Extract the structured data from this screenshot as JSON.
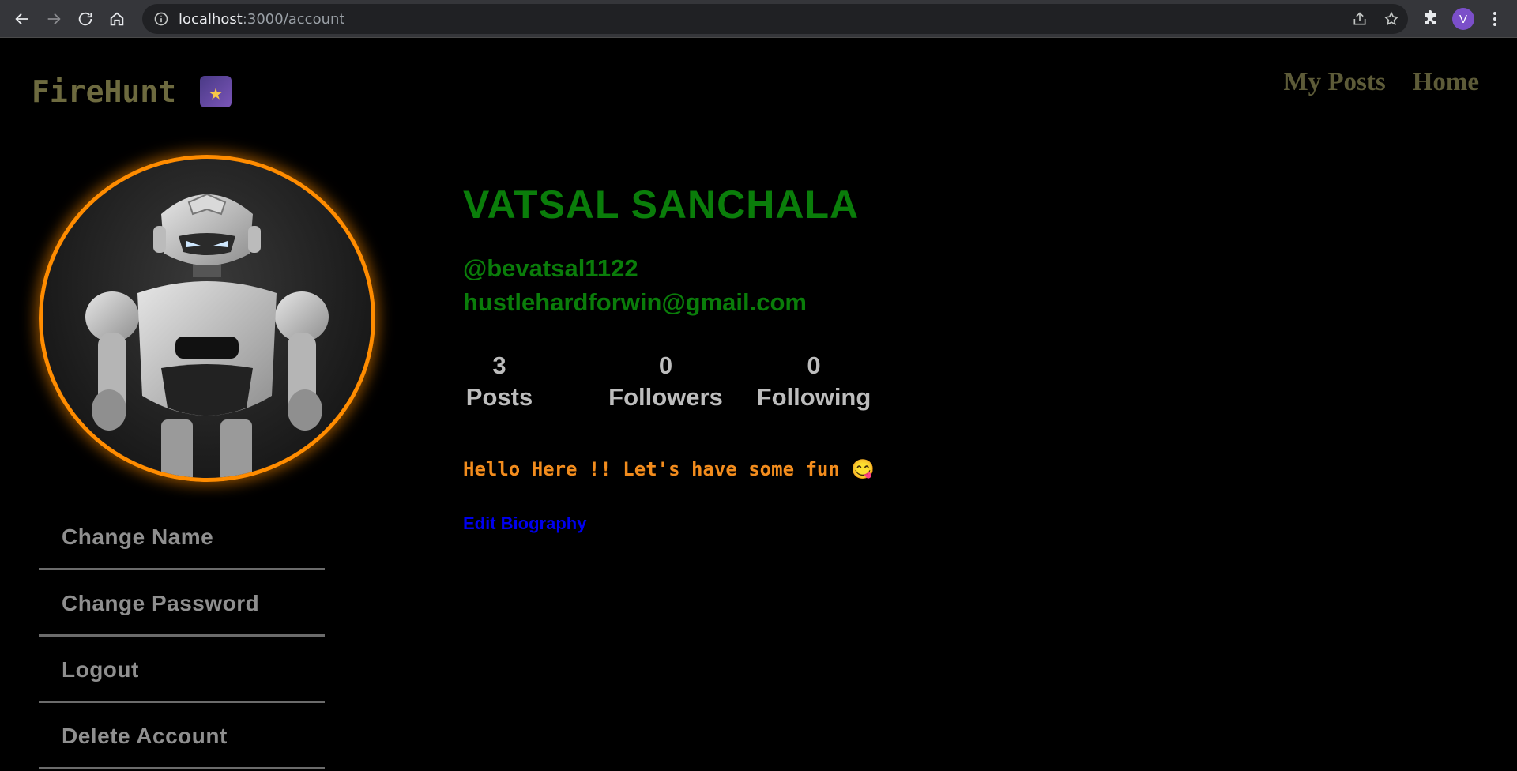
{
  "browser": {
    "url_host": "localhost",
    "url_path": ":3000/account",
    "profile_initial": "V"
  },
  "header": {
    "logo_text": "FireHunt",
    "logo_icon": "shooting-star-icon",
    "nav": [
      {
        "label": "My Posts"
      },
      {
        "label": "Home"
      }
    ]
  },
  "profile": {
    "name": "VATSAL SANCHALA",
    "handle": "@bevatsal1122",
    "email": "hustlehardforwin@gmail.com",
    "stats": [
      {
        "value": "3",
        "label": "Posts"
      },
      {
        "value": "0",
        "label": "Followers"
      },
      {
        "value": "0",
        "label": "Following"
      }
    ],
    "bio": "Hello Here !! Let's have some fun 😋",
    "edit_bio_label": "Edit Biography"
  },
  "sidebar": {
    "items": [
      {
        "label": "Change Name"
      },
      {
        "label": "Change Password"
      },
      {
        "label": "Logout"
      },
      {
        "label": "Delete Account"
      }
    ]
  },
  "colors": {
    "accent_ring": "#ff8c00",
    "name_green": "#0a7d0a",
    "bio_orange": "#f28c1d",
    "link_blue": "#0000ee"
  }
}
